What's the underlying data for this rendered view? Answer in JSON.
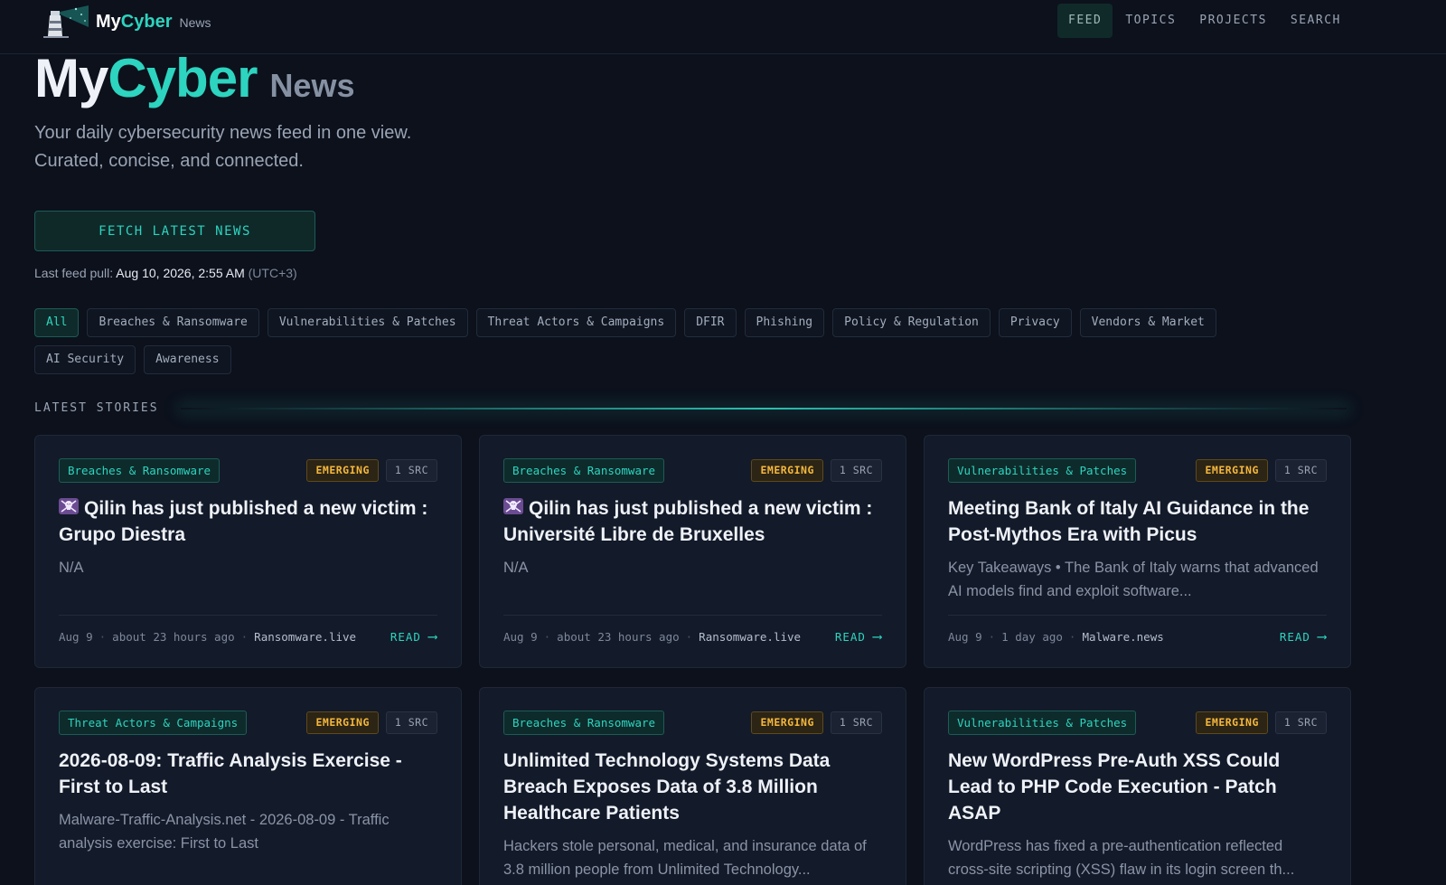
{
  "brand": {
    "my": "My",
    "cyber": "Cyber",
    "news": "News"
  },
  "nav": [
    {
      "label": "FEED",
      "active": true
    },
    {
      "label": "TOPICS"
    },
    {
      "label": "PROJECTS"
    },
    {
      "label": "SEARCH"
    }
  ],
  "hero": {
    "title_my": "My",
    "title_cyber": "Cyber",
    "title_news": "News",
    "subtitle_line1": "Your daily cybersecurity news feed in one view.",
    "subtitle_line2": "Curated, concise, and connected.",
    "fetch_button": "FETCH LATEST NEWS",
    "last_pull_label": "Last feed pull:",
    "last_pull_value": "Aug 10, 2026, 2:55 AM",
    "last_pull_tz": "(UTC+3)"
  },
  "filters": [
    {
      "label": "All",
      "active": true
    },
    {
      "label": "Breaches & Ransomware"
    },
    {
      "label": "Vulnerabilities & Patches"
    },
    {
      "label": "Threat Actors & Campaigns"
    },
    {
      "label": "DFIR"
    },
    {
      "label": "Phishing"
    },
    {
      "label": "Policy & Regulation"
    },
    {
      "label": "Privacy"
    },
    {
      "label": "Vendors & Market"
    },
    {
      "label": "AI Security"
    },
    {
      "label": "Awareness"
    }
  ],
  "section": {
    "label": "LATEST STORIES"
  },
  "colors": {
    "accent": "#2dd4bf",
    "background": "#0c111c",
    "card": "#131a29",
    "emerging": "#f5b83d"
  },
  "cards": [
    {
      "category": "Breaches & Ransomware",
      "status": "EMERGING",
      "sources": "1 SRC",
      "icon": "skull-crossbones-icon",
      "title": "Qilin has just published a new victim : Grupo Diestra",
      "desc": "N/A",
      "date": "Aug 9",
      "ago": "about 23 hours ago",
      "source": "Ransomware.live",
      "read": "READ"
    },
    {
      "category": "Breaches & Ransomware",
      "status": "EMERGING",
      "sources": "1 SRC",
      "icon": "skull-crossbones-icon",
      "title": "Qilin has just published a new victim : Université Libre de Bruxelles",
      "desc": "N/A",
      "date": "Aug 9",
      "ago": "about 23 hours ago",
      "source": "Ransomware.live",
      "read": "READ"
    },
    {
      "category": "Vulnerabilities & Patches",
      "status": "EMERGING",
      "sources": "1 SRC",
      "title": "Meeting Bank of Italy AI Guidance in the Post-Mythos Era with Picus",
      "desc": "Key Takeaways • The Bank of Italy warns that advanced AI models find and exploit software...",
      "date": "Aug 9",
      "ago": "1 day ago",
      "source": "Malware.news",
      "read": "READ"
    },
    {
      "category": "Threat Actors & Campaigns",
      "status": "EMERGING",
      "sources": "1 SRC",
      "title": "2026-08-09: Traffic Analysis Exercise - First to Last",
      "desc": "Malware-Traffic-Analysis.net - 2026-08-09 - Traffic analysis exercise: First to Last"
    },
    {
      "category": "Breaches & Ransomware",
      "status": "EMERGING",
      "sources": "1 SRC",
      "title": "Unlimited Technology Systems Data Breach Exposes Data of 3.8 Million Healthcare Patients",
      "desc": "Hackers stole personal, medical, and insurance data of 3.8 million people from Unlimited Technology..."
    },
    {
      "category": "Vulnerabilities & Patches",
      "status": "EMERGING",
      "sources": "1 SRC",
      "title": "New WordPress Pre-Auth XSS Could Lead to PHP Code Execution - Patch ASAP",
      "desc": "WordPress has fixed a pre-authentication reflected cross-site scripting (XSS) flaw in its login screen th..."
    }
  ]
}
